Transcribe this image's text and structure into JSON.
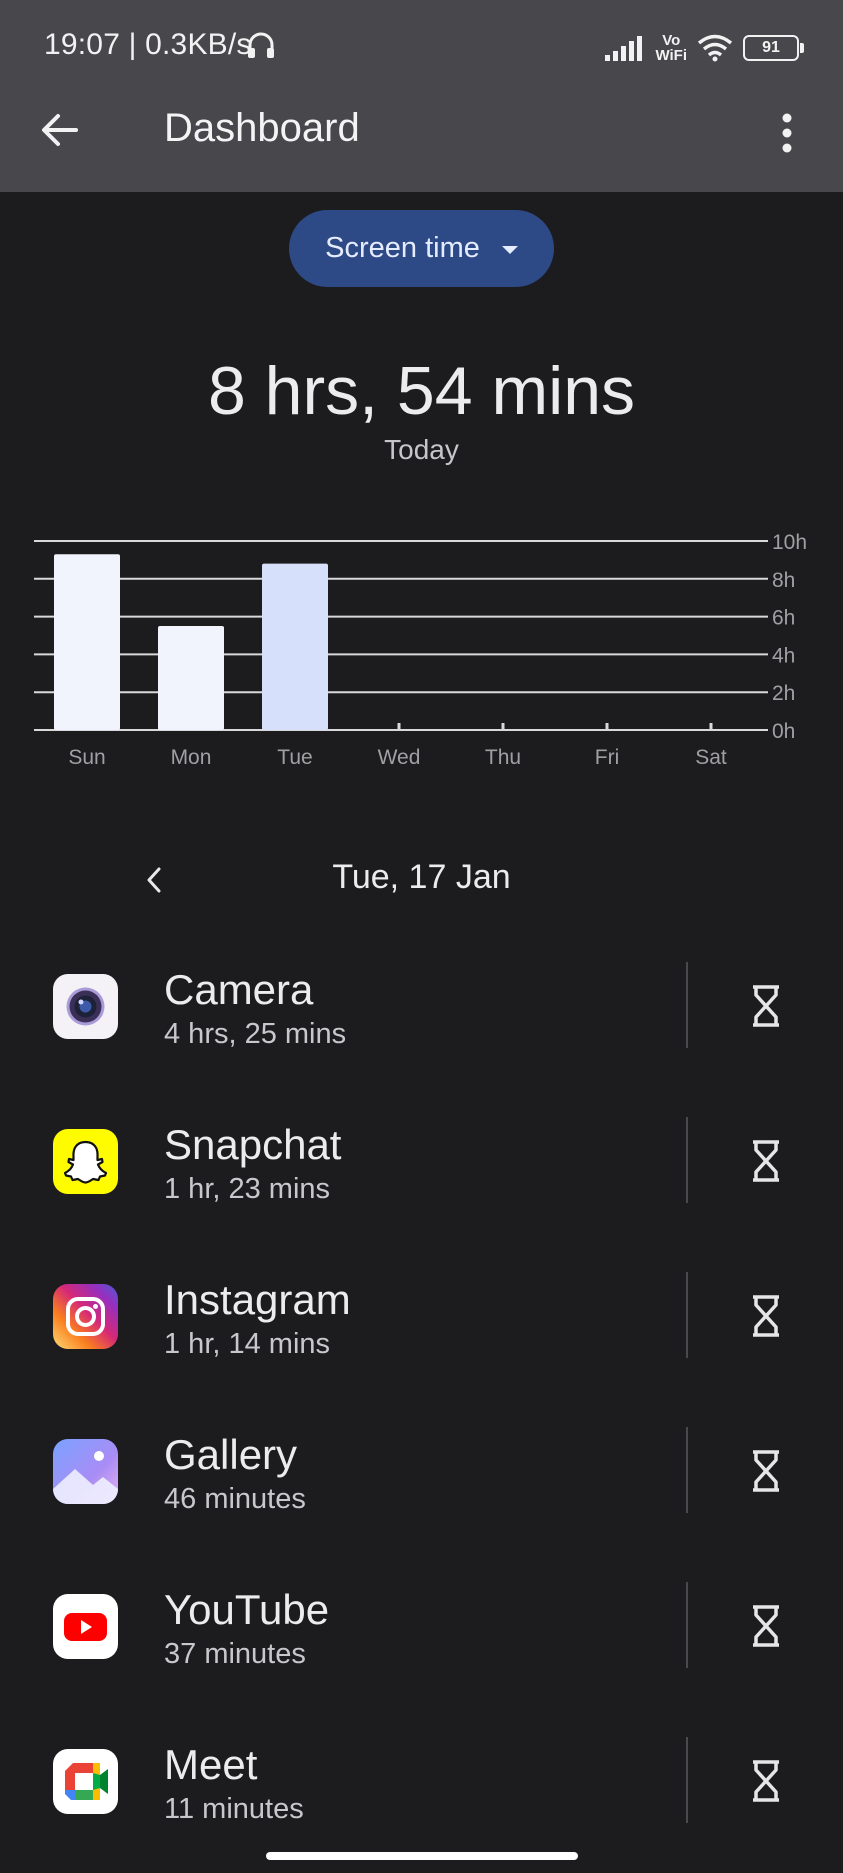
{
  "status_bar": {
    "time_speed": "19:07 | 0.3KB/s",
    "network_label_top": "Vo",
    "network_label_bottom": "WiFi",
    "battery": "91"
  },
  "header": {
    "title": "Dashboard",
    "back_icon": "arrow-left-icon",
    "menu_icon": "more-vert-icon"
  },
  "metric_dropdown": {
    "label": "Screen time",
    "icon": "caret-down-icon"
  },
  "summary": {
    "total": "8 hrs, 54 mins",
    "period": "Today"
  },
  "chart_data": {
    "type": "bar",
    "categories": [
      "Sun",
      "Mon",
      "Tue",
      "Wed",
      "Thu",
      "Fri",
      "Sat"
    ],
    "values": [
      9.3,
      5.5,
      8.8,
      0,
      0,
      0,
      0
    ],
    "selected_index": 2,
    "y_ticks": [
      "10h",
      "8h",
      "6h",
      "4h",
      "2h",
      "0h"
    ],
    "y_tick_values": [
      10,
      8,
      6,
      4,
      2,
      0
    ],
    "ylim": [
      0,
      10
    ],
    "grid": true,
    "bar_color": "#f2f4fd",
    "selected_bar_color": "#d7e0fb",
    "grid_color": "#d9d9dc",
    "label_color": "#a0a0a4"
  },
  "date_nav": {
    "label": "Tue, 17 Jan",
    "prev_icon": "chevron-left-icon"
  },
  "apps": [
    {
      "name": "Camera",
      "usage": "4 hrs, 25 mins",
      "icon": "camera-icon"
    },
    {
      "name": "Snapchat",
      "usage": "1 hr, 23 mins",
      "icon": "snapchat-icon"
    },
    {
      "name": "Instagram",
      "usage": "1 hr, 14 mins",
      "icon": "instagram-icon"
    },
    {
      "name": "Gallery",
      "usage": "46 minutes",
      "icon": "gallery-icon"
    },
    {
      "name": "YouTube",
      "usage": "37 minutes",
      "icon": "youtube-icon"
    },
    {
      "name": "Meet",
      "usage": "11 minutes",
      "icon": "meet-icon"
    }
  ],
  "app_action_icon": "hourglass-icon"
}
